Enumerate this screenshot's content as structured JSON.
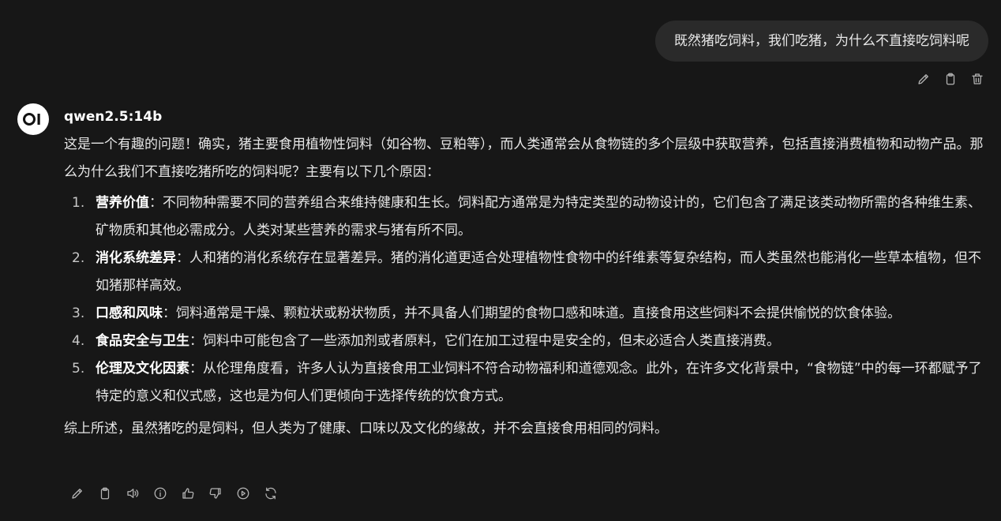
{
  "user_message": "既然猪吃饲料，我们吃猪，为什么不直接吃饲料呢",
  "user_actions": [
    "edit-icon",
    "copy-icon",
    "delete-icon"
  ],
  "assistant": {
    "avatar_logo": "OI",
    "model_name": "qwen2.5:14b",
    "intro": "这是一个有趣的问题！确实，猪主要食用植物性饲料（如谷物、豆粕等），而人类通常会从食物链的多个层级中获取营养，包括直接消费植物和动物产品。那么为什么我们不直接吃猪所吃的饲料呢？主要有以下几个原因：",
    "reasons": [
      {
        "num": "1.",
        "title": "营养价值",
        "sep": "：",
        "text": "不同物种需要不同的营养组合来维持健康和生长。饲料配方通常是为特定类型的动物设计的，它们包含了满足该类动物所需的各种维生素、矿物质和其他必需成分。人类对某些营养的需求与猪有所不同。"
      },
      {
        "num": "2.",
        "title": "消化系统差异",
        "sep": "：",
        "text": "人和猪的消化系统存在显著差异。猪的消化道更适合处理植物性食物中的纤维素等复杂结构，而人类虽然也能消化一些草本植物，但不如猪那样高效。"
      },
      {
        "num": "3.",
        "title": "口感和风味",
        "sep": "：",
        "text": "饲料通常是干燥、颗粒状或粉状物质，并不具备人们期望的食物口感和味道。直接食用这些饲料不会提供愉悦的饮食体验。"
      },
      {
        "num": "4.",
        "title": "食品安全与卫生",
        "sep": "：",
        "text": "饲料中可能包含了一些添加剂或者原料，它们在加工过程中是安全的，但未必适合人类直接消费。"
      },
      {
        "num": "5.",
        "title": "伦理及文化因素",
        "sep": "：",
        "text": "从伦理角度看，许多人认为直接食用工业饲料不符合动物福利和道德观念。此外，在许多文化背景中，“食物链”中的每一环都赋予了特定的意义和仪式感，这也是为何人们更倾向于选择传统的饮食方式。"
      }
    ],
    "summary": "综上所述，虽然猪吃的是饲料，但人类为了健康、口味以及文化的缘故，并不会直接食用相同的饲料。",
    "actions": [
      "edit-icon",
      "copy-icon",
      "read-aloud-icon",
      "info-icon",
      "thumbs-up-icon",
      "thumbs-down-icon",
      "continue-icon",
      "regenerate-icon"
    ]
  },
  "colors": {
    "background": "#171717",
    "bubble": "#2a2a2a",
    "text": "#e6e6e6",
    "icon": "#b4b4b4"
  }
}
